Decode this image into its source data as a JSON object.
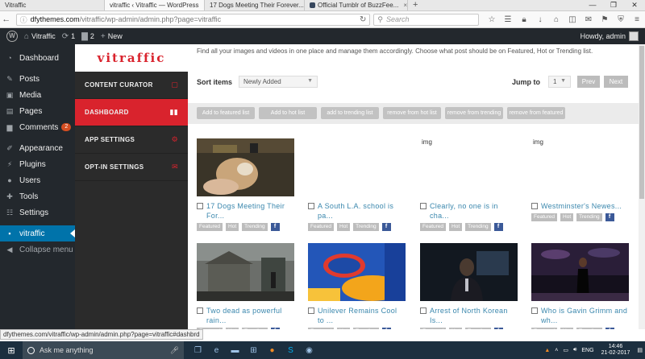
{
  "browser": {
    "tabs": [
      {
        "label": "Vitraffic",
        "active": false
      },
      {
        "label": "vitraffic ‹ Vitraffic — WordPress",
        "active": true
      },
      {
        "label": "17 Dogs Meeting Their Forever...",
        "active": false
      },
      {
        "label": "Official Tumblr of BuzzFee...",
        "active": false
      }
    ],
    "url_host": "dfythemes.com",
    "url_path": "/vitraffic/wp-admin/admin.php?page=vitraffic",
    "search_placeholder": "Search"
  },
  "adminbar": {
    "site_name": "Vitraffic",
    "updates_count": "1",
    "comments_count": "2",
    "new_label": "New",
    "howdy": "Howdy, admin"
  },
  "wp_menu": {
    "dashboard": "Dashboard",
    "posts": "Posts",
    "media": "Media",
    "pages": "Pages",
    "comments": "Comments",
    "comments_badge": "2",
    "appearance": "Appearance",
    "plugins": "Plugins",
    "users": "Users",
    "tools": "Tools",
    "settings": "Settings",
    "vitraffic": "vitraffic",
    "collapse": "Collapse menu"
  },
  "plugin": {
    "logo": "vitraffic",
    "menu": [
      {
        "label": "CONTENT CURATOR",
        "icon": "file-icon"
      },
      {
        "label": "DASHBOARD",
        "icon": "chart-icon"
      },
      {
        "label": "APP SETTINGS",
        "icon": "gear-icon"
      },
      {
        "label": "OPT-IN SETTINGS",
        "icon": "envelope-icon"
      }
    ]
  },
  "main": {
    "intro": "Find all your images and videos in one place and manage them accordingly. Choose what post should be on Featured, Hot or Trending list.",
    "sort_label": "Sort items",
    "sort_value": "Newly Added",
    "jump_label": "Jump to",
    "jump_value": "1",
    "prev": "Prev",
    "next": "Next",
    "actions": [
      "Add to featured list",
      "Add to hot list",
      "add to trending list",
      "remove from hot list",
      "remove from trending",
      "remove from featured"
    ],
    "tags": {
      "featured": "Featured",
      "hot": "Hot",
      "trending": "Trending",
      "fb": "f"
    },
    "cards": [
      {
        "title": "17 Dogs Meeting Their For...",
        "image": "dog-photo"
      },
      {
        "title": "A South L.A. school is pa...",
        "image": "blank"
      },
      {
        "title": "Clearly, no one is in cha...",
        "image": "broken",
        "alt": "img"
      },
      {
        "title": "Westminster's Newes...",
        "image": "broken",
        "alt": "img"
      },
      {
        "title": "Two dead as powerful rain...",
        "image": "storm-photo"
      },
      {
        "title": "Unilever Remains Cool to ...",
        "image": "kraft-photo"
      },
      {
        "title": "Arrest of North Korean Is...",
        "image": "anchor-photo"
      },
      {
        "title": "Who is Gavin Grimm and wh...",
        "image": "stage-photo"
      }
    ]
  },
  "status_url": "dfythemes.com/vitraffic/wp-admin/admin.php?page=vitraffic#dashbrd",
  "taskbar": {
    "search_placeholder": "Ask me anything",
    "lang": "ENG",
    "time": "14:46",
    "date": "21-02-2017"
  },
  "colors": {
    "wp_dark": "#23282d",
    "wp_blue": "#0073aa",
    "brand_red": "#d9232d",
    "link_blue": "#3a87ad",
    "fb_blue": "#3b5998"
  }
}
